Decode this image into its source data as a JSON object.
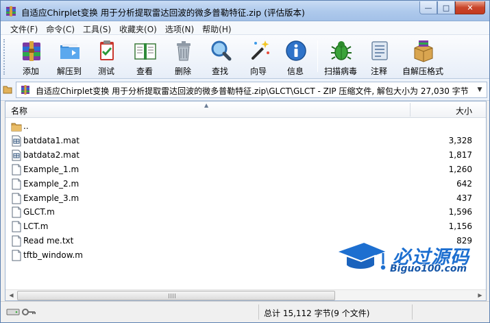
{
  "window": {
    "title": "自适应Chirplet变换 用于分析提取雷达回波的微多普勒特征.zip (评估版本)",
    "minimize": "—",
    "maximize": "□",
    "close": "✕"
  },
  "menu": [
    "文件(F)",
    "命令(C)",
    "工具(S)",
    "收藏夹(O)",
    "选项(N)",
    "帮助(H)"
  ],
  "toolbar": {
    "add": "添加",
    "extract": "解压到",
    "test": "测试",
    "view": "查看",
    "delete": "删除",
    "find": "查找",
    "wizard": "向导",
    "info": "信息",
    "scan": "扫描病毒",
    "comment": "注释",
    "sfx": "自解压格式"
  },
  "address": {
    "path": "自适应Chirplet变换 用于分析提取雷达回波的微多普勒特征.zip\\GLCT\\GLCT - ZIP 压缩文件, 解包大小为 27,030 字节",
    "dropdown": "▼"
  },
  "columns": {
    "name": "名称",
    "size": "大小",
    "sort_arrow": "▲"
  },
  "files": [
    {
      "name": "..",
      "size": "",
      "icon": "folder-icon"
    },
    {
      "name": "batdata1.mat",
      "size": "3,328",
      "icon": "mat-file-icon"
    },
    {
      "name": "batdata2.mat",
      "size": "1,817",
      "icon": "mat-file-icon"
    },
    {
      "name": "Example_1.m",
      "size": "1,260",
      "icon": "text-file-icon"
    },
    {
      "name": "Example_2.m",
      "size": "642",
      "icon": "text-file-icon"
    },
    {
      "name": "Example_3.m",
      "size": "437",
      "icon": "text-file-icon"
    },
    {
      "name": "GLCT.m",
      "size": "1,596",
      "icon": "text-file-icon"
    },
    {
      "name": "LCT.m",
      "size": "1,156",
      "icon": "text-file-icon"
    },
    {
      "name": "Read me.txt",
      "size": "829",
      "icon": "text-file-icon"
    },
    {
      "name": "tftb_window.m",
      "size": "",
      "icon": "text-file-icon"
    }
  ],
  "scrollbar": {
    "left": "◀",
    "right": "▶"
  },
  "status": {
    "total": "总计 15,112 字节(9 个文件)"
  },
  "watermark": {
    "title": "必过源码",
    "url": "Biguo100.com"
  },
  "colors": {
    "titlebar": "#aec9ec",
    "accent": "#1d6fd0",
    "close": "#c9452a"
  }
}
